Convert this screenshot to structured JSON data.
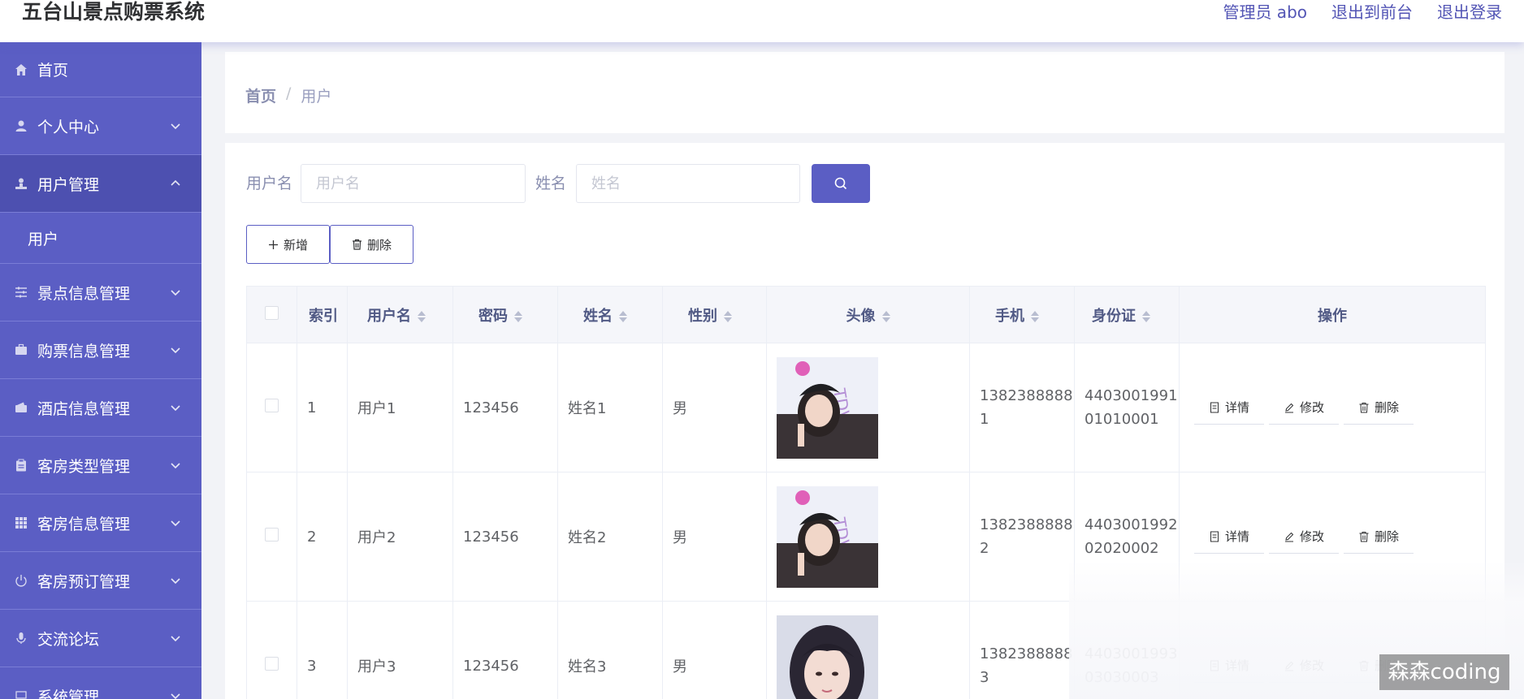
{
  "app": {
    "title": "五台山景点购票系统",
    "admin_label": "管理员 abo",
    "exit_front": "退出到前台",
    "logout": "退出登录"
  },
  "sidebar": {
    "items": [
      {
        "label": "首页",
        "icon": "home-icon"
      },
      {
        "label": "个人中心",
        "icon": "user-icon"
      },
      {
        "label": "用户管理",
        "icon": "user-manage-icon",
        "open": true
      },
      {
        "label": "景点信息管理",
        "icon": "sliders-icon"
      },
      {
        "label": "购票信息管理",
        "icon": "briefcase-icon"
      },
      {
        "label": "酒店信息管理",
        "icon": "wallet-icon"
      },
      {
        "label": "客房类型管理",
        "icon": "clipboard-icon"
      },
      {
        "label": "客房信息管理",
        "icon": "grid-icon"
      },
      {
        "label": "客房预订管理",
        "icon": "power-icon"
      },
      {
        "label": "交流论坛",
        "icon": "mic-icon"
      },
      {
        "label": "系统管理",
        "icon": "settings-icon"
      }
    ],
    "submenu": {
      "label": "用户"
    }
  },
  "breadcrumb": {
    "home": "首页",
    "separator": "/",
    "current": "用户"
  },
  "search": {
    "username_label": "用户名",
    "username_placeholder": "用户名",
    "name_label": "姓名",
    "name_placeholder": "姓名"
  },
  "actions": {
    "add": "新增",
    "delete": "删除"
  },
  "table": {
    "headers": {
      "index": "索引",
      "username": "用户名",
      "password": "密码",
      "name": "姓名",
      "gender": "性别",
      "avatar": "头像",
      "phone": "手机",
      "idcard": "身份证",
      "ops": "操作"
    },
    "rows": [
      {
        "index": "1",
        "username": "用户1",
        "password": "123456",
        "name": "姓名1",
        "gender": "男",
        "phone": "13823888881",
        "idcard": "440300199101010001"
      },
      {
        "index": "2",
        "username": "用户2",
        "password": "123456",
        "name": "姓名2",
        "gender": "男",
        "phone": "13823888882",
        "idcard": "440300199202020002"
      },
      {
        "index": "3",
        "username": "用户3",
        "password": "123456",
        "name": "姓名3",
        "gender": "男",
        "phone": "13823888883",
        "idcard": "440300199303030003"
      }
    ],
    "op_labels": {
      "detail": "详情",
      "edit": "修改",
      "delete": "删除"
    }
  },
  "watermark": "森森coding",
  "colors": {
    "primary": "#5b5ec4",
    "sidebar_open": "#4d50b0",
    "link": "#5355b5"
  }
}
